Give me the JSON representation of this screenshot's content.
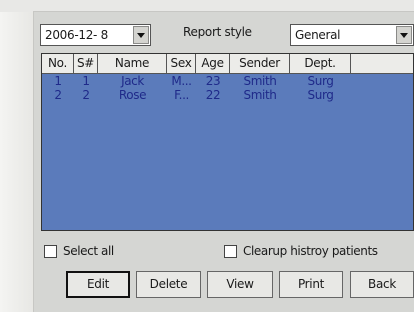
{
  "date_combo": {
    "value": "2006-12- 8"
  },
  "report_style": {
    "label": "Report style",
    "value": "General"
  },
  "table": {
    "headers": [
      "No.",
      "S#",
      "Name",
      "Sex",
      "Age",
      "Sender",
      "Dept."
    ],
    "rows": [
      [
        "1",
        "1",
        "Jack",
        "M...",
        "23",
        "Smith",
        "Surg"
      ],
      [
        "2",
        "2",
        "Rose",
        "F...",
        "22",
        "Smith",
        "Surg"
      ]
    ]
  },
  "options": {
    "select_all": "Select all",
    "clearup": "Clearup histroy patients"
  },
  "buttons": {
    "edit": "Edit",
    "delete": "Delete",
    "view": "View",
    "print": "Print",
    "back": "Back"
  },
  "colors": {
    "grid_background": "#5b7bbb",
    "row_text": "#1f2a8a",
    "panel": "#d5d6d3"
  }
}
